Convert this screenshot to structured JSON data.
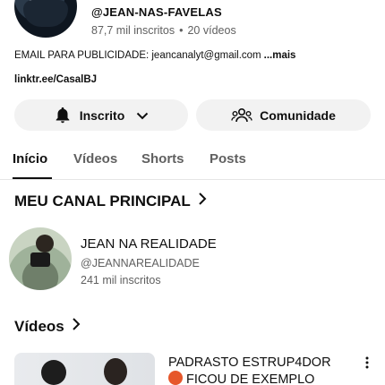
{
  "channel": {
    "handle": "@JEAN-NAS-FAVELAS",
    "subscribers": "87,7 mil inscritos",
    "separator": "•",
    "videos_count": "20 vídeos",
    "about": "EMAIL PARA PUBLICIDADE: jeancanalyt@gmail.com",
    "more_label": "...mais",
    "link": "linktr.ee/CasalBJ"
  },
  "actions": {
    "subscribed_label": "Inscrito",
    "community_label": "Comunidade"
  },
  "tabs": [
    {
      "label": "Início",
      "active": true
    },
    {
      "label": "Vídeos",
      "active": false
    },
    {
      "label": "Shorts",
      "active": false
    },
    {
      "label": "Posts",
      "active": false
    }
  ],
  "main_channel_section": {
    "title": "MEU CANAL PRINCIPAL",
    "channel_name": "JEAN NA REALIDADE",
    "channel_handle": "@JEANNAREALIDADE",
    "channel_subscribers": "241 mil inscritos"
  },
  "videos_section": {
    "title": "Vídeos",
    "first_video": {
      "title_line1": "PADRASTO ESTRUP4DOR",
      "title_line2": "FICOU DE EXEMPLO"
    }
  },
  "colors": {
    "text_primary": "#0f0f0f",
    "text_secondary": "#606060",
    "pill_bg": "#f2f2f2",
    "divider": "#e5e5e5"
  }
}
